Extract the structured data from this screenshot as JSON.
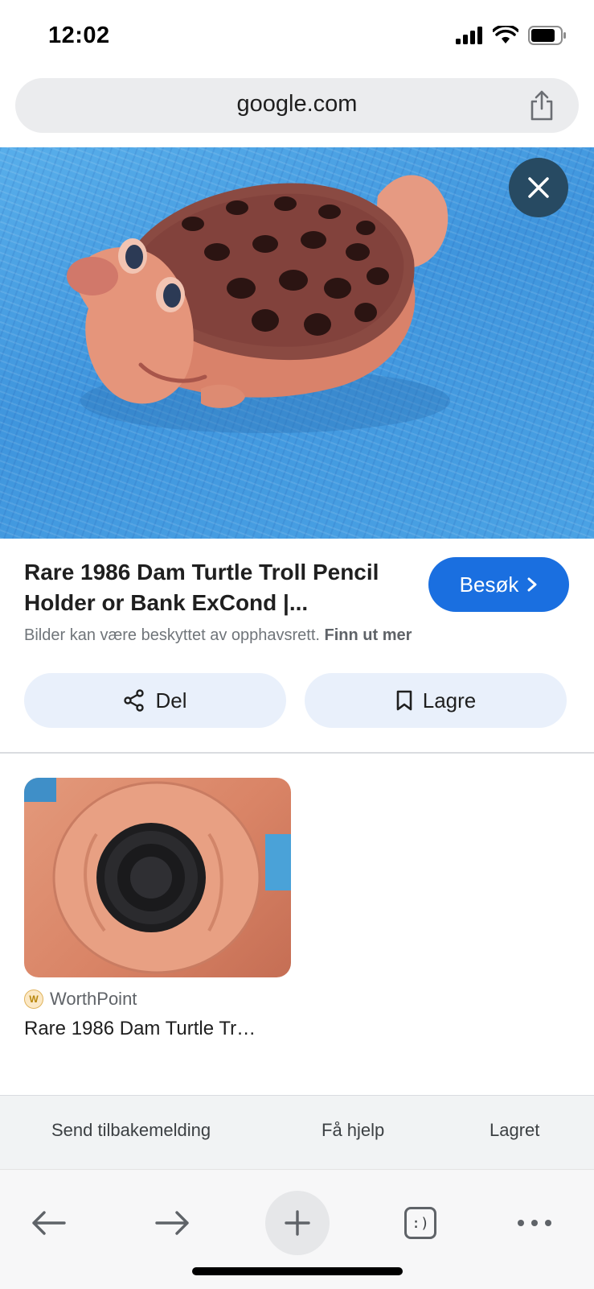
{
  "status_bar": {
    "time": "12:02",
    "icons": [
      "cellular-signal-icon",
      "wifi-icon",
      "battery-icon"
    ]
  },
  "browser": {
    "url": "google.com"
  },
  "viewer": {
    "image_subject": "turtle-troll-toy-photo",
    "title": "Rare 1986 Dam Turtle Troll Pencil Holder or Bank ExCond |...",
    "visit_label": "Besøk",
    "copyright_text": "Bilder kan være beskyttet av opphavsrett.",
    "copyright_link": "Finn ut mer",
    "share_label": "Del",
    "save_label": "Lagre"
  },
  "related": [
    {
      "source": "WorthPoint",
      "title": "Rare 1986 Dam Turtle Tr…",
      "image_subject": "troll-bank-underside-photo"
    }
  ],
  "footer": {
    "feedback": "Send tilbakemelding",
    "help": "Få hjelp",
    "saved": "Lagret"
  },
  "toolbar": {
    "items": [
      "back-arrow-icon",
      "forward-arrow-icon",
      "new-tab-plus-icon",
      "tabs-switcher-icon",
      "more-dots-icon"
    ],
    "tabs_glyph": ":)"
  },
  "colors": {
    "accent_blue": "#1a6fe0",
    "close_button": "#274a62",
    "action_button_bg": "#e9f0fb"
  }
}
